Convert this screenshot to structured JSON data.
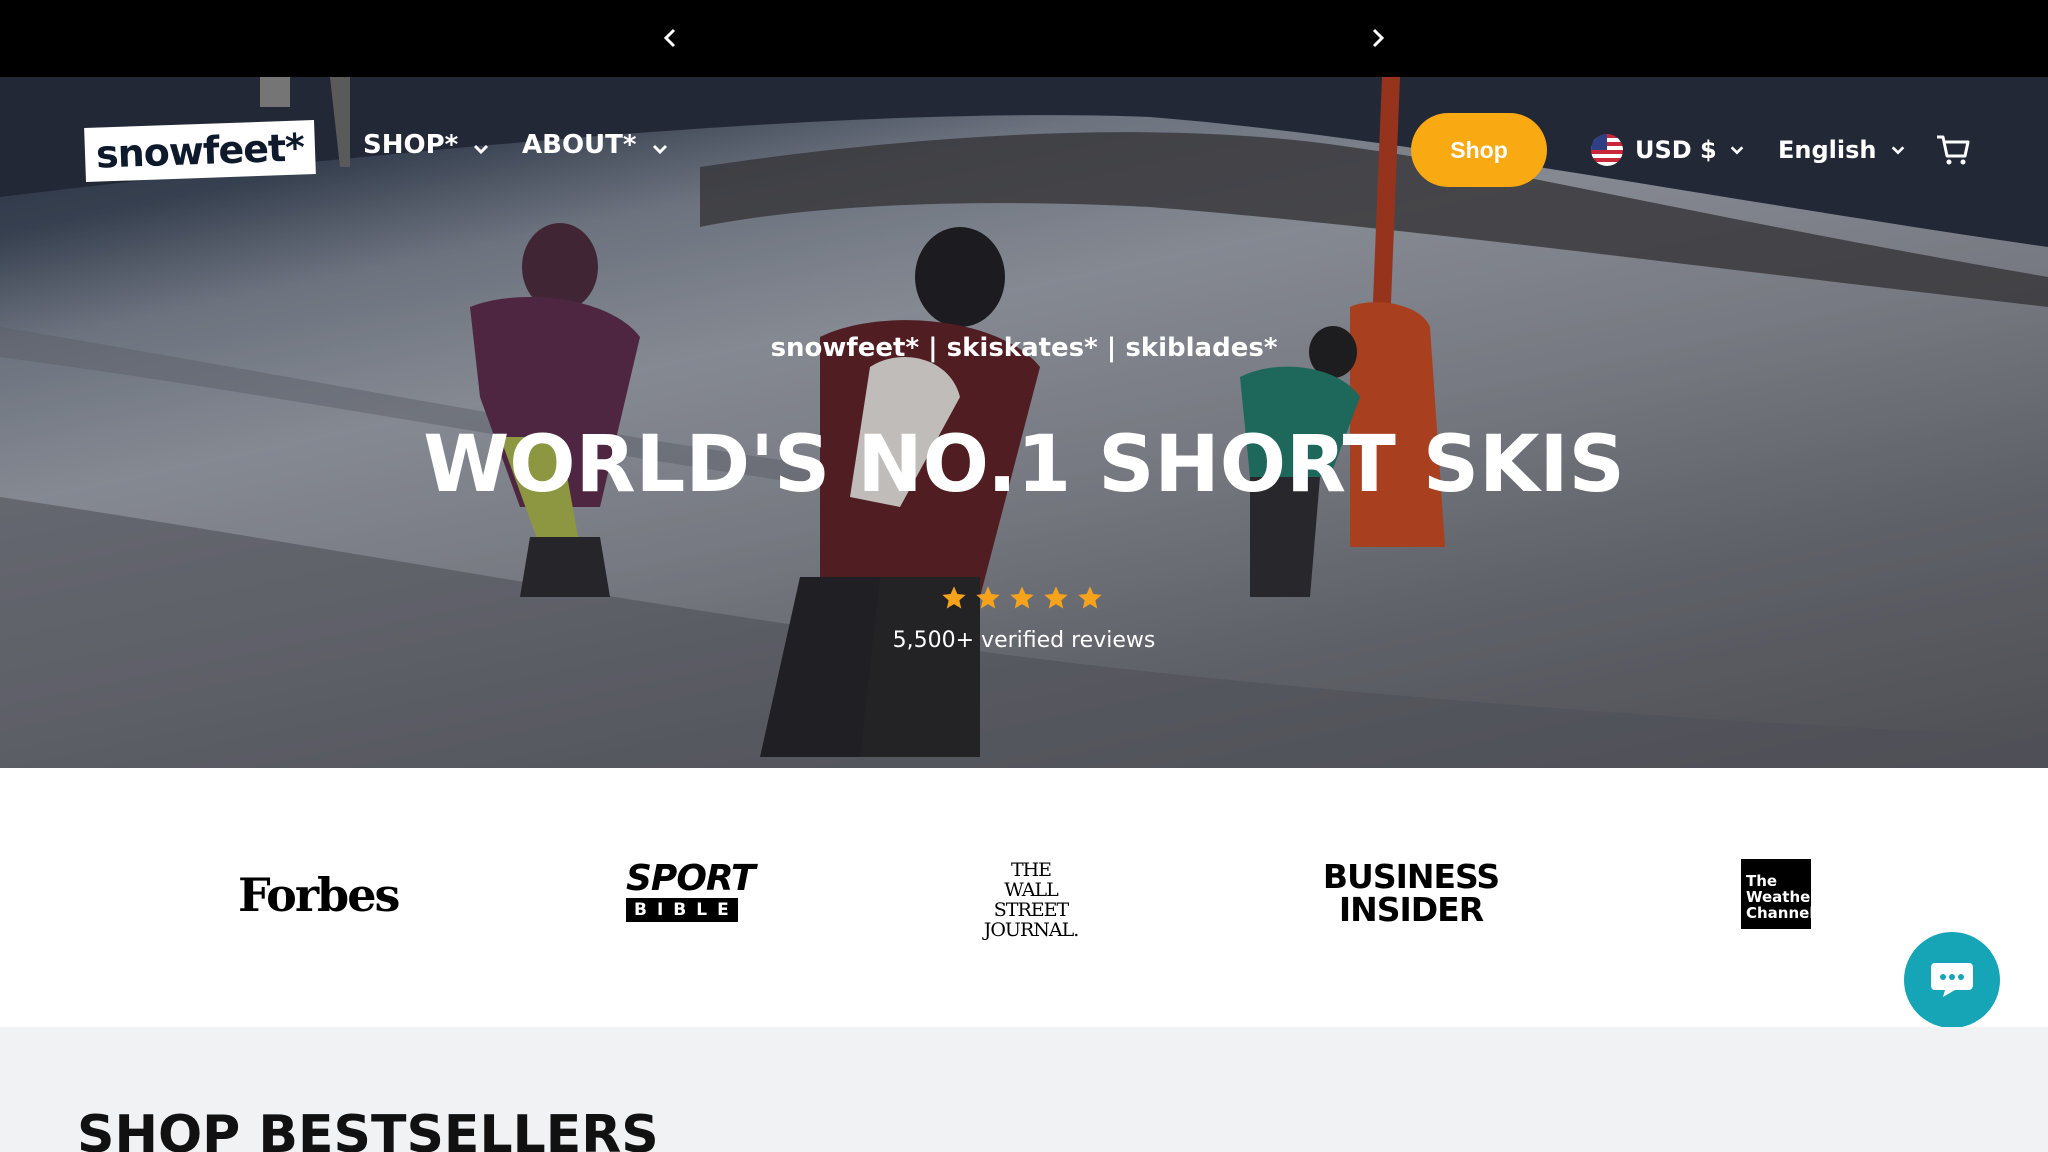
{
  "header": {
    "logo_text": "snowfeet*",
    "nav": [
      {
        "label": "SHOP*"
      },
      {
        "label": "ABOUT*"
      }
    ],
    "shop_button": "Shop",
    "currency": "USD $",
    "language": "English",
    "icons": [
      "chevron-left-icon",
      "chevron-right-icon",
      "chevron-down-icon",
      "us-flag-icon",
      "cart-icon",
      "chat-icon",
      "star-icon"
    ]
  },
  "hero": {
    "tagline": "snowfeet* | skiskates* | skiblades*",
    "headline": "WORLD'S NO.1 SHORT SKIS",
    "rating_stars": 5,
    "reviews_text": "5,500+ verified reviews"
  },
  "press": {
    "forbes": "Forbes",
    "sport_top": "SPORT",
    "sport_bottom": "BIBLE",
    "wsj_line1": "THE",
    "wsj_line2": "WALL STREET",
    "wsj_line3": "JOURNAL.",
    "bi_line1": "BUSINESS",
    "bi_line2": "INSIDER",
    "twc_line1": "The",
    "twc_line2": "Weather",
    "twc_line3": "Channel"
  },
  "section": {
    "title": "SHOP BESTSELLERS"
  },
  "colors": {
    "accent": "#f9a912",
    "chat": "#16a5b6",
    "star": "#f6a31b",
    "announce_bg": "#000000",
    "section_bg": "#f1f2f4"
  }
}
